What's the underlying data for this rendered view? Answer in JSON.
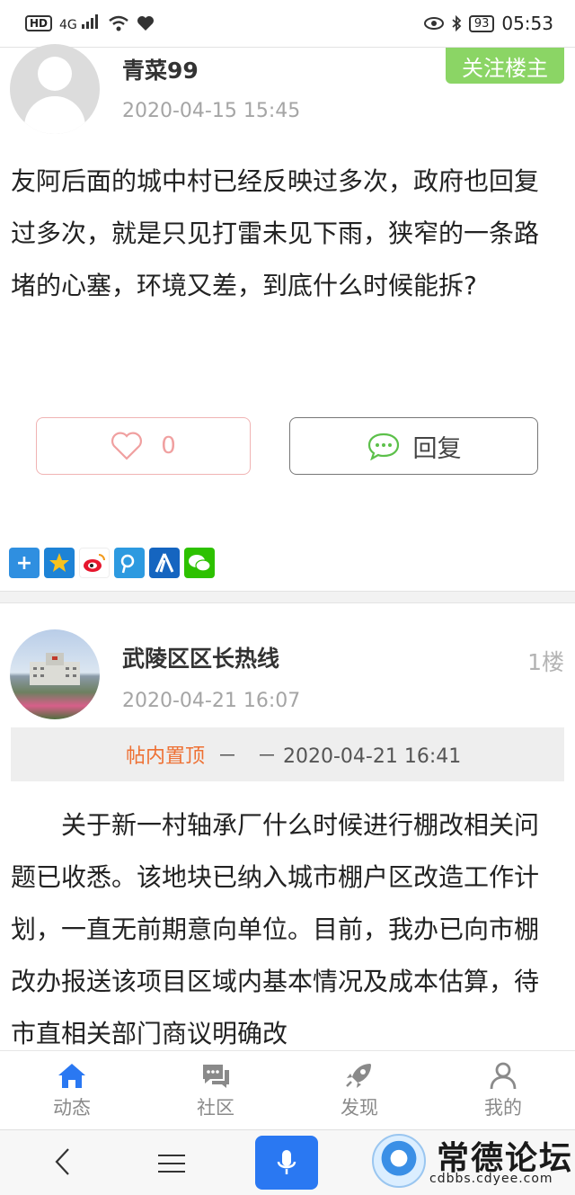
{
  "status_bar": {
    "network": "HD",
    "signal": "4G",
    "battery": "93",
    "time": "05:53"
  },
  "post": {
    "username": "青菜99",
    "date": "2020-04-15 15:45",
    "follow_label": "关注楼主",
    "content": "友阿后面的城中村已经反映过多次，政府也回复过多次，就是只见打雷未见下雨，狭窄的一条路堵的心塞，环境又差，到底什么时候能拆?",
    "like_count": "0",
    "reply_label": "回复",
    "share_icons": [
      "add-icon",
      "qzone-icon",
      "weibo-icon",
      "tencent-weibo-icon",
      "renren-icon",
      "wechat-icon"
    ]
  },
  "reply": {
    "username": "武陵区区长热线",
    "date": "2020-04-21 16:07",
    "floor": "1楼",
    "pin_label": "帖内置顶",
    "pin_text": "－　－ 2020-04-21 16:41",
    "content": "关于新一村轴承厂什么时候进行棚改相关问题已收悉。该地块已纳入城市棚户区改造工作计划，一直无前期意向单位。目前，我办已向市棚改办报送该项目区域内基本情况及成本估算，待市直相关部门商议明确改"
  },
  "tabs": [
    {
      "label": "动态",
      "icon": "home-icon",
      "active": true
    },
    {
      "label": "社区",
      "icon": "chat-icon",
      "active": false
    },
    {
      "label": "发现",
      "icon": "rocket-icon",
      "active": false
    },
    {
      "label": "我的",
      "icon": "user-icon",
      "active": false
    }
  ],
  "watermark": {
    "title": "常德论坛",
    "url": "cdbbs.cdyee.com"
  },
  "colors": {
    "follow": "#8bd565",
    "accent_blue": "#2a78f2",
    "pin_orange": "#ee7033",
    "tab_active": "#2a78f2"
  }
}
